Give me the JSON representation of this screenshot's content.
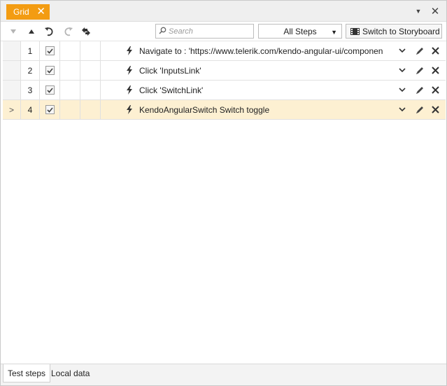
{
  "tab": {
    "title": "Grid",
    "close_glyph": "✕"
  },
  "window_controls": {
    "menu_glyph": "▼",
    "close_glyph": "✕"
  },
  "toolbar": {
    "search_placeholder": "Search",
    "filter_selected": "All Steps",
    "switch_label": "Switch to Storyboard"
  },
  "grid": {
    "rows": [
      {
        "indicator": "",
        "num": "1",
        "checked": true,
        "description": "Navigate to : 'https://www.telerik.com/kendo-angular-ui/componen",
        "selected": false
      },
      {
        "indicator": "",
        "num": "2",
        "checked": true,
        "description": "Click 'InputsLink'",
        "selected": false
      },
      {
        "indicator": "",
        "num": "3",
        "checked": true,
        "description": "Click 'SwitchLink'",
        "selected": false
      },
      {
        "indicator": ">",
        "num": "4",
        "checked": true,
        "description": "KendoAngularSwitch Switch toggle",
        "selected": true
      }
    ]
  },
  "bottom_tabs": {
    "active": "Test steps",
    "other": "Local data"
  },
  "colors": {
    "accent": "#f39c12",
    "selected_row": "#fdf0d2"
  }
}
